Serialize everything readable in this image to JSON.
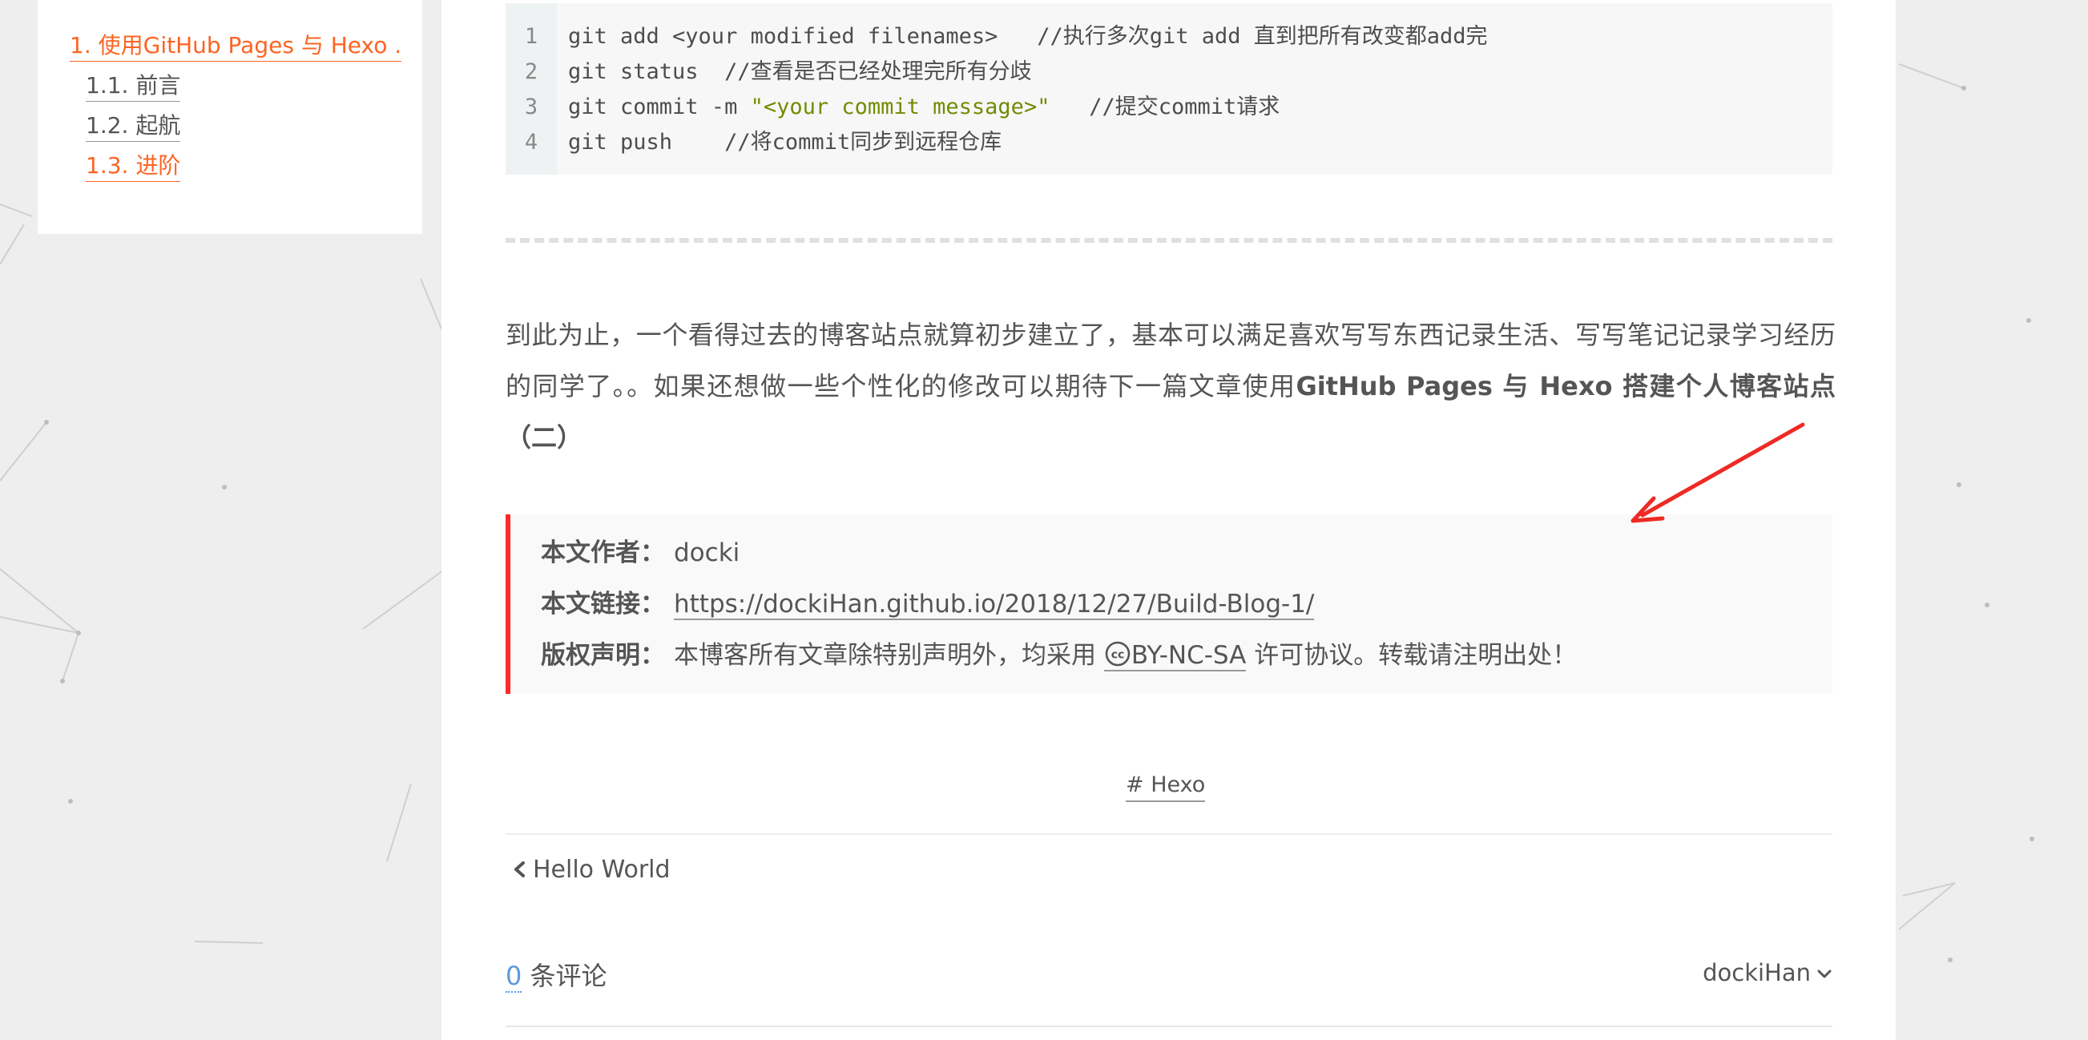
{
  "toc": {
    "items": [
      {
        "label": "1. 使用GitHub Pages 与 Hexo ...",
        "active": true
      },
      {
        "label": "1.1. 前言",
        "active": false
      },
      {
        "label": "1.2. 起航",
        "active": false
      },
      {
        "label": "1.3. 进阶",
        "active": true
      }
    ]
  },
  "code": {
    "line_numbers": [
      "1",
      "2",
      "3",
      "4"
    ],
    "lines": [
      {
        "pre": "git add <your modified filenames>   //执行多次git add 直到把所有改变都add完",
        "str": "",
        "post": ""
      },
      {
        "pre": "git status  //查看是否已经处理完所有分歧",
        "str": "",
        "post": ""
      },
      {
        "pre": "git commit -m ",
        "str": "\"<your commit message>\"",
        "post": "   //提交commit请求"
      },
      {
        "pre": "git push    //将commit同步到远程仓库",
        "str": "",
        "post": ""
      }
    ]
  },
  "article": {
    "paragraph_text": "到此为止，一个看得过去的博客站点就算初步建立了，基本可以满足喜欢写写东西记录生活、写写笔记记录学习经历的同学了。。如果还想做一些个性化的修改可以期待下一篇文章使用",
    "paragraph_bold": "GitHub Pages 与 Hexo 搭建个人博客站点（二）"
  },
  "copyright": {
    "author_label": "本文作者：",
    "author": "docki",
    "link_label": "本文链接：",
    "link": "https://dockiHan.github.io/2018/12/27/Build-Blog-1/",
    "license_label": "版权声明：",
    "license_pre": "本博客所有文章除特别声明外，均采用 ",
    "license_link": "BY-NC-SA",
    "license_post": " 许可协议。转载请注明出处！"
  },
  "tags": {
    "tag": "# Hexo"
  },
  "nav": {
    "prev_post": "Hello World"
  },
  "comments": {
    "count": "0",
    "label": " 条评论",
    "user": "dockiHan"
  },
  "colors": {
    "accent": "#fc6423",
    "copyright_border": "#ff2a2a",
    "string": "#718c00",
    "count_link": "#5d9ae0",
    "annotation_arrow": "#ee2a24"
  },
  "icons": {
    "prev": "chevron-left-icon",
    "user_menu": "chevron-down-icon",
    "license": "creative-commons-icon"
  }
}
